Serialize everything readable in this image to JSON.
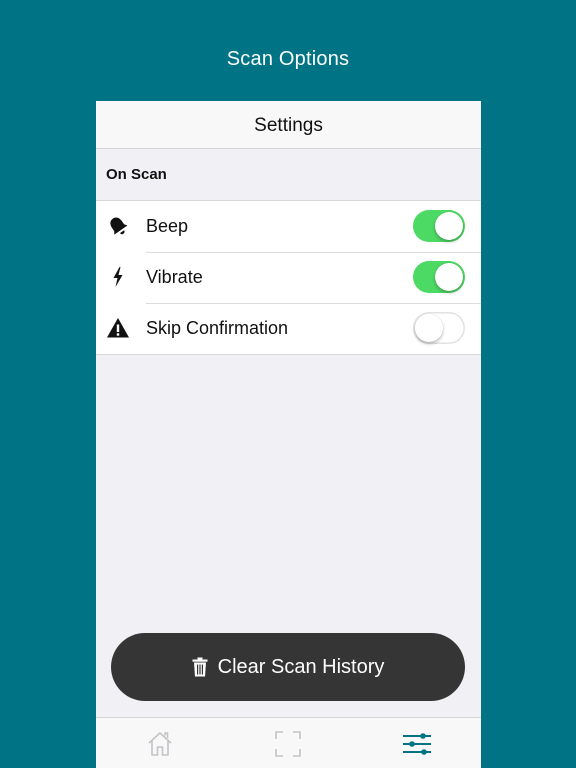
{
  "header": {
    "title": "Scan Options"
  },
  "nav": {
    "title": "Settings"
  },
  "section": {
    "title": "On Scan"
  },
  "settings": [
    {
      "label": "Beep",
      "icon": "bell-icon",
      "enabled": true
    },
    {
      "label": "Vibrate",
      "icon": "lightning-bolt-icon",
      "enabled": true
    },
    {
      "label": "Skip Confirmation",
      "icon": "warning-triangle-icon",
      "enabled": false
    }
  ],
  "clear_button": {
    "label": "Clear Scan History",
    "icon": "trash-icon"
  },
  "tabs": [
    {
      "icon": "home-icon",
      "selected": false
    },
    {
      "icon": "scan-frame-icon",
      "selected": false
    },
    {
      "icon": "sliders-icon",
      "selected": true
    }
  ],
  "colors": {
    "background": "#007484",
    "accent": "#007484",
    "toggle_on": "#4cd964",
    "button": "#353535",
    "tab_inactive": "#c4c4c8"
  }
}
